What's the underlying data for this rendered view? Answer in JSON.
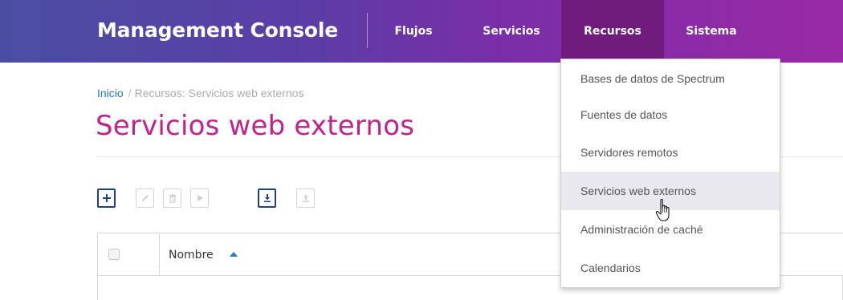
{
  "header": {
    "brand": "Management Console",
    "nav": [
      {
        "label": "Flujos"
      },
      {
        "label": "Servicios"
      },
      {
        "label": "Recursos",
        "active": true
      },
      {
        "label": "Sistema"
      }
    ],
    "active_color": "#711b7e"
  },
  "breadcrumb": {
    "home": "Inicio",
    "separator": "/",
    "current": "Recursos: Servicios web externos"
  },
  "page": {
    "title": "Servicios web externos",
    "title_color": "#c2238a"
  },
  "toolbar": {
    "buttons": [
      {
        "icon": "plus-icon",
        "enabled": true
      },
      {
        "icon": "pencil-icon",
        "enabled": false
      },
      {
        "icon": "trash-icon",
        "enabled": false
      },
      {
        "icon": "play-icon",
        "enabled": false
      },
      {
        "icon": "download-icon",
        "enabled": true
      },
      {
        "icon": "upload-icon",
        "enabled": false
      }
    ]
  },
  "table": {
    "columns": [
      {
        "label": "Nombre",
        "sort": "ascending"
      }
    ],
    "rows": []
  },
  "dropdown": {
    "items": [
      {
        "label": "Bases de datos de Spectrum"
      },
      {
        "label": "Fuentes de datos"
      },
      {
        "label": "Servidores remotos"
      },
      {
        "label": "Servicios web externos",
        "hovered": true
      },
      {
        "label": "Administración de caché"
      },
      {
        "label": "Calendarios"
      }
    ]
  }
}
